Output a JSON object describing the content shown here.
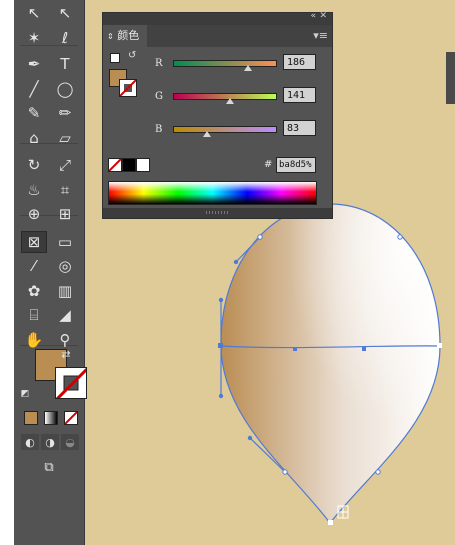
{
  "colors": {
    "canvas": "#dfcb98",
    "fill": "#ba8d53",
    "panel": "#535353",
    "path_stroke": "#4f7ad6"
  },
  "color_panel": {
    "title": "颜色",
    "collapse_icon": "double-chevron-left-icon",
    "menu_icon": "panel-menu-icon",
    "channels": [
      {
        "label": "R",
        "value": "186",
        "fraction": 0.729
      },
      {
        "label": "G",
        "value": "141",
        "fraction": 0.553
      },
      {
        "label": "B",
        "value": "83",
        "fraction": 0.325
      }
    ],
    "hex_label": "#",
    "hex_value": "ba8d5%"
  },
  "toolbar": {
    "tools": [
      {
        "name": "selection-tool-icon",
        "glyph": "↖"
      },
      {
        "name": "direct-selection-tool-icon",
        "glyph": "↖"
      },
      {
        "name": "magic-wand-tool-icon",
        "glyph": "✶"
      },
      {
        "name": "lasso-tool-icon",
        "glyph": "ℓ"
      },
      {
        "name": "pen-tool-icon",
        "glyph": "✒"
      },
      {
        "name": "type-tool-icon",
        "glyph": "T"
      },
      {
        "name": "line-tool-icon",
        "glyph": "╱"
      },
      {
        "name": "ellipse-tool-icon",
        "glyph": "◯"
      },
      {
        "name": "paintbrush-tool-icon",
        "glyph": "✎"
      },
      {
        "name": "pencil-tool-icon",
        "glyph": "✏"
      },
      {
        "name": "blob-brush-tool-icon",
        "glyph": "⌂"
      },
      {
        "name": "eraser-tool-icon",
        "glyph": "▱"
      },
      {
        "name": "rotate-tool-icon",
        "glyph": "↻"
      },
      {
        "name": "scale-tool-icon",
        "glyph": "⤢"
      },
      {
        "name": "warp-tool-icon",
        "glyph": "♨"
      },
      {
        "name": "free-transform-tool-icon",
        "glyph": "⌗"
      },
      {
        "name": "shape-builder-tool-icon",
        "glyph": "⊕"
      },
      {
        "name": "perspective-grid-tool-icon",
        "glyph": "⊞"
      },
      {
        "name": "mesh-tool-icon",
        "glyph": "⊠"
      },
      {
        "name": "gradient-tool-icon",
        "glyph": "▭"
      },
      {
        "name": "eyedropper-tool-icon",
        "glyph": "⁄"
      },
      {
        "name": "blend-tool-icon",
        "glyph": "◎"
      },
      {
        "name": "symbol-sprayer-tool-icon",
        "glyph": "✿"
      },
      {
        "name": "column-graph-tool-icon",
        "glyph": "▥"
      },
      {
        "name": "artboard-tool-icon",
        "glyph": "⌸"
      },
      {
        "name": "slice-tool-icon",
        "glyph": "◢"
      },
      {
        "name": "hand-tool-icon",
        "glyph": "✋"
      },
      {
        "name": "zoom-tool-icon",
        "glyph": "⚲"
      }
    ],
    "active_tool": "mesh-tool-icon",
    "draw_modes": [
      "draw-normal-icon",
      "draw-behind-icon",
      "draw-inside-icon"
    ],
    "screen_mode": "screen-mode-icon"
  }
}
